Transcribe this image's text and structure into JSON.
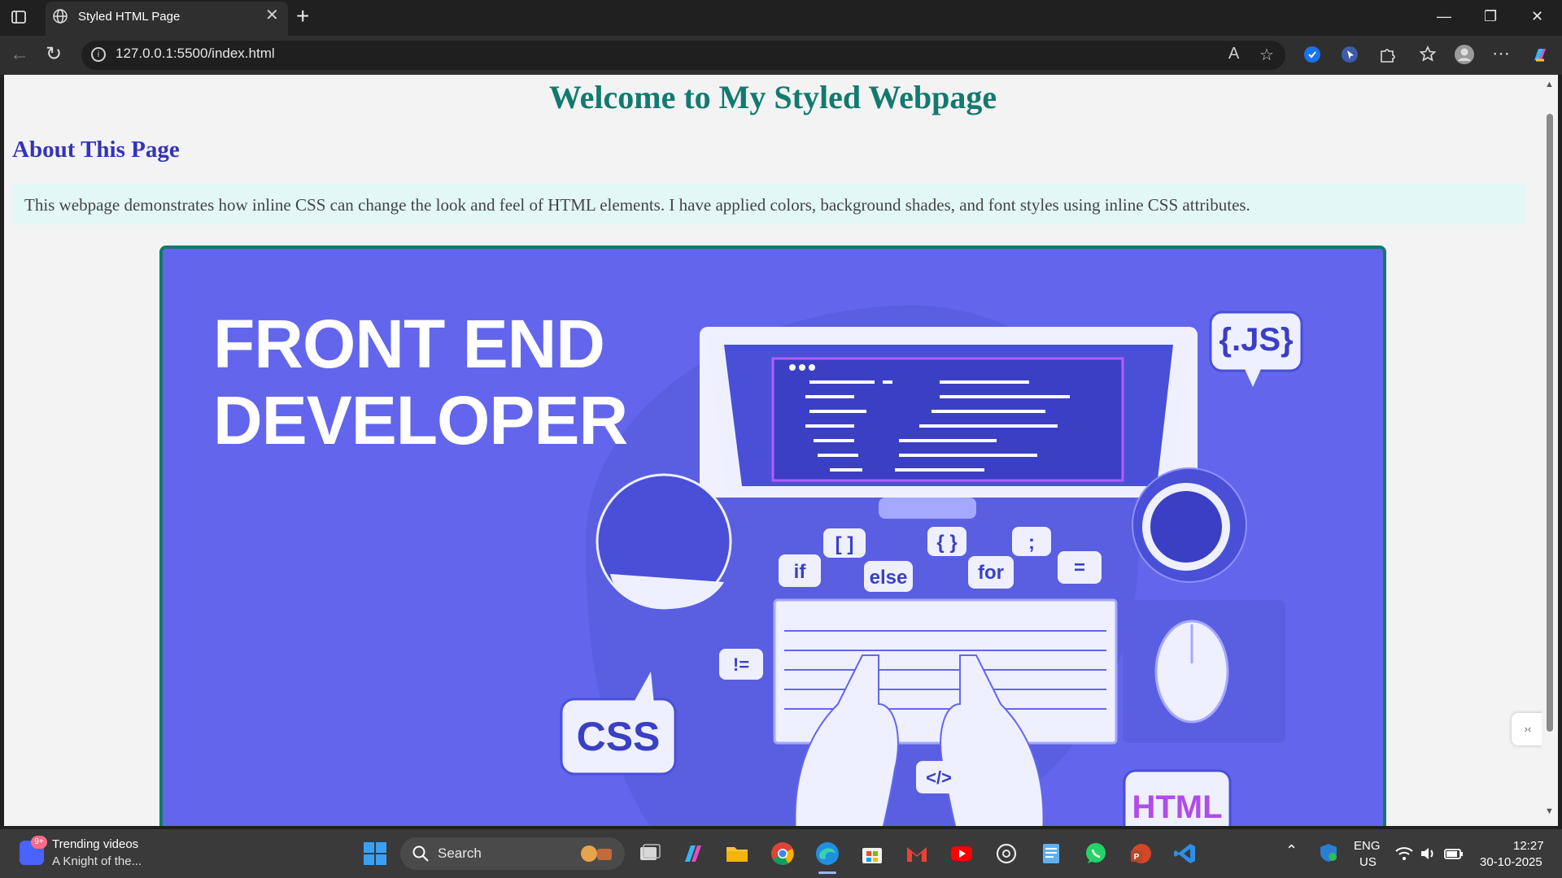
{
  "browser": {
    "tab_title": "Styled HTML Page",
    "tab_close": "✕",
    "new_tab": "+",
    "url": "127.0.0.1:5500/index.html",
    "window": {
      "minimize": "—",
      "maximize": "❐",
      "close": "✕"
    }
  },
  "page": {
    "heading": "Welcome to My Styled Webpage",
    "subheading": "About This Page",
    "paragraph": "This webpage demonstrates how inline CSS can change the look and feel of HTML elements. I have applied colors, background shades, and font styles using inline CSS attributes.",
    "hero": {
      "title": "FRONT END\nDEVELOPER",
      "bubbles": [
        "{.JS}",
        "if",
        "[ ]",
        "else",
        "{ }",
        "for",
        ";",
        "=",
        "!=",
        "CSS",
        "</>",
        "HTML"
      ]
    }
  },
  "taskbar": {
    "news_badge": "9+",
    "news_title": "Trending videos",
    "news_sub": "A Knight of the...",
    "search_label": "Search",
    "language_line1": "ENG",
    "language_line2": "US",
    "time": "12:27",
    "date": "30-10-2025"
  },
  "colors": {
    "heading": "#127a6e",
    "subheading": "#3333bb",
    "paragraph_bg": "#e3f7f7",
    "hero_bg": "#6366ec",
    "hero_border": "#127a6e"
  }
}
